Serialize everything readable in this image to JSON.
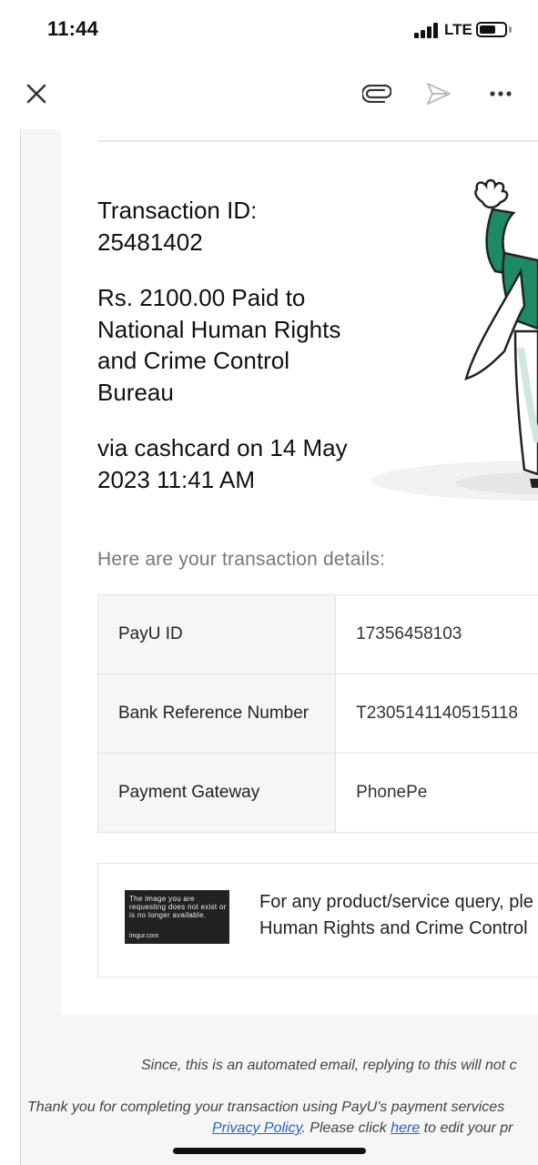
{
  "status_bar": {
    "time": "11:44",
    "network": "LTE"
  },
  "toolbar": {
    "close_icon": "close-icon",
    "attach_icon": "paperclip-icon",
    "send_icon": "send-icon",
    "more_icon": "more-horizontal-icon"
  },
  "email": {
    "transaction_id_text": "Transaction ID: 25481402",
    "paid_text": "Rs. 2100.00 Paid to National Human Rights and Crime Control Bureau",
    "via_text": "via cashcard on 14 May 2023 11:41 AM",
    "details_heading": "Here are your transaction details:",
    "details": [
      {
        "label": "PayU ID",
        "value": "17356458103"
      },
      {
        "label": "Bank Reference Number",
        "value": "T2305141140515118"
      },
      {
        "label": "Payment Gateway",
        "value": "PhonePe"
      }
    ],
    "broken_image": {
      "message": "The image you are requesting does not exist or is no longer available.",
      "source": "imgur.com"
    },
    "query_line_1": "For any product/service query, ple",
    "query_line_2": "Human Rights and Crime Control",
    "footer_automated": "Since, this is an automated email, replying to this will not c",
    "footer_thanks": "Thank you for completing your transaction using PayU's payment services",
    "footer_privacy_link": "Privacy Policy",
    "footer_middle": ". Please click ",
    "footer_here_link": "here",
    "footer_end": " to edit your pr"
  },
  "colors": {
    "accent_green": "#1e8a64",
    "link_blue": "#2a63c4"
  }
}
